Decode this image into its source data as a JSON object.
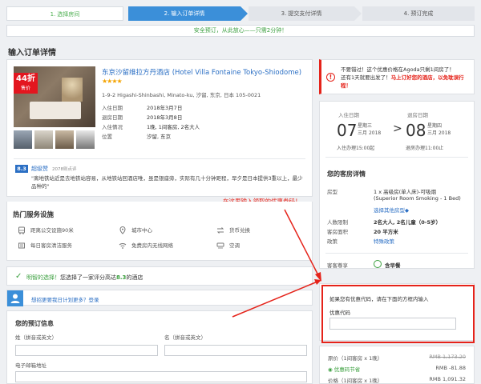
{
  "steps": [
    {
      "num": "1.",
      "label": "选择房间"
    },
    {
      "num": "2.",
      "label": "输入订单详情"
    },
    {
      "num": "3.",
      "label": "提交支付详情"
    },
    {
      "num": "4.",
      "label": "预订完成"
    }
  ],
  "secure_banner": "安全预订，从此放心——只需2分钟！",
  "section_title": "输入订单详情",
  "hotel": {
    "discount": "44折",
    "discount_label": "售价",
    "name": "东京沙留维拉方丹酒店 (Hotel Villa Fontaine Tokyo-Shiodome)",
    "stars": "★★★★",
    "address": "1-9-2 Higashi-Shinbashi, Minato-ku, 汐留, 东京, 日本 105-0021",
    "checkin_label": "入住日期",
    "checkin_value": "2018年3月7日",
    "checkout_label": "退房日期",
    "checkout_value": "2018年3月8日",
    "stay_label": "入住情况",
    "stay_value": "1晚, 1间客房, 2名大人",
    "location_label": "位置",
    "location_value": "汐留, 东京",
    "score": "8.3",
    "score_label": "超级赞",
    "score_count": "2078则点评",
    "review": "\"离地铁站近是去地铁站容易，从地铁站回酒店唯，虽是银座旁，实际有几十分钟距程，早夕是日本提供3重以上，最少品种的\""
  },
  "amenities_title": "热门服务设施",
  "amenities": [
    "距离公交设施90米",
    "城市中心",
    "货币兑换",
    "每日客房清洁服务",
    "免费房内无线网络",
    "空调"
  ],
  "coupon_hint": "在这里输入领取的优惠券码！",
  "green_notice": {
    "prefix": "明智的选择！",
    "middle": "您选择了一家评分高达",
    "score": "8.3",
    "suffix": "的酒店"
  },
  "member_link": "想招更要我日计划更多？登录",
  "form": {
    "title": "您的预订信息",
    "last_name_label": "姓（拼音或英文）",
    "first_name_label": "名（拼音或英文）",
    "email_label": "电子邮箱地址"
  },
  "promo": {
    "line1": "不要错过！这个优惠价格在Agoda只剩1间房了！",
    "line2_prefix": "还有1天就要出发了！",
    "line2_red": "马上订好您的酒店，以免耽误行程！"
  },
  "dates": {
    "checkin_label": "入住日期",
    "checkin_day": "07",
    "checkin_weekday": "星期三",
    "checkin_month": "三月",
    "checkin_year": "2018",
    "checkin_time": "入住办理15:00起",
    "checkout_label": "退房日期",
    "checkout_day": "08",
    "checkout_weekday": "星期四",
    "checkout_month": "三月",
    "checkout_year": "2018",
    "checkout_time": "退房办理11:00止"
  },
  "room": {
    "title": "您的客房详情",
    "type_label": "房型",
    "type_value": "1 x 高级房(单人床)-可吸烟",
    "type_en": "(Superior Room Smoking - 1 Bed)",
    "other_types": "选择其他房型◆",
    "people_label": "人数限制",
    "people_value": "2名大人, 2名儿童（0-5岁）",
    "area_label": "客房面积",
    "area_value": "20 平方米",
    "policy_label": "政策",
    "policy_value": "特殊政策",
    "benefit_label": "客客尊享",
    "benefit_value": "含早餐"
  },
  "coupon": {
    "text": "如果您有优惠代码，请在下面的方框内输入",
    "label": "优惠代码",
    "value": ""
  },
  "price": {
    "original_label": "原价（1间客房 x 1晚）",
    "original_value": "RMB 1,173.20",
    "discount_label": "优惠码节省",
    "discount_value": "RMB -81.88",
    "final_label": "价格（1间客房 x 1晚）",
    "final_value": "RMB 1,091.32"
  },
  "colors": {
    "accent_blue": "#3b8fd9",
    "link_blue": "#2b6fc4",
    "success_green": "#3a9f3e",
    "alert_red": "#e5231a",
    "star_gold": "#f4a300"
  }
}
